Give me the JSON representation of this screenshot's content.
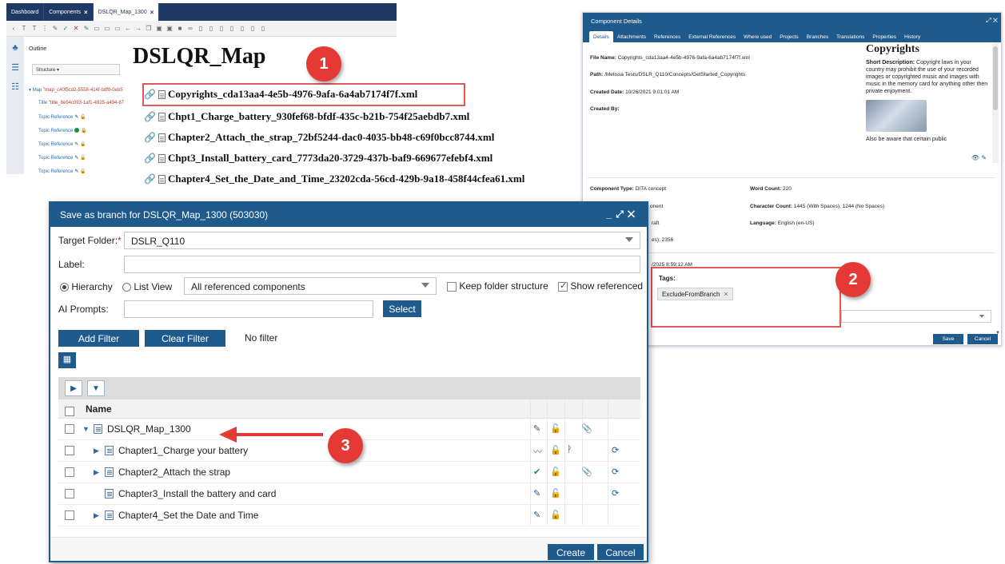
{
  "editor": {
    "tabs": [
      {
        "label": "Dashboard",
        "closable": false
      },
      {
        "label": "Components",
        "closable": true
      },
      {
        "label": "DSLQR_Map_1300",
        "closable": true
      }
    ],
    "outline_label": "Outline",
    "structure_label": "Structure ▾",
    "tree": [
      {
        "type": "Map",
        "value": "\"map_c40f5cd2-5558-414f-bdf0-0eb5"
      },
      {
        "type": "Title",
        "value": "\"title_8e54c093-1af1-4925-a494-87"
      },
      {
        "type": "Topic Reference",
        "status": "edit"
      },
      {
        "type": "Topic Reference",
        "status": "ok"
      },
      {
        "type": "Topic Reference",
        "status": "edit"
      },
      {
        "type": "Topic Reference",
        "status": "edit"
      },
      {
        "type": "Topic Reference",
        "status": "edit"
      }
    ],
    "doc_title": "DSLQR_Map",
    "links": [
      "Copyrights_cda13aa4-4e5b-4976-9afa-6a4ab7174f7f.xml",
      "Chpt1_Charge_battery_930fef68-bfdf-435c-b21b-754f25aebdb7.xml",
      "Chapter2_Attach_the_strap_72bf5244-dac0-4035-bb48-c69f0bcc8744.xml",
      "Chpt3_Install_battery_card_7773da20-3729-437b-baf9-669677efebf4.xml",
      "Chapter4_Set_the_Date_and_Time_23202cda-56cd-429b-9a18-458f44cfea61.xml"
    ]
  },
  "badges": [
    "1",
    "2",
    "3"
  ],
  "details": {
    "title": "Component Details",
    "tabs": [
      "Details",
      "Attachments",
      "References",
      "External References",
      "Where used",
      "Projects",
      "Branches",
      "Translations",
      "Properties",
      "History"
    ],
    "file_name_label": "File Name:",
    "file_name": "Copyrights_cda13aa4-4e5b-4976-9afa-6a4ab7174f7f.xml",
    "path_label": "Path:",
    "path": "/Melissa Tests/DSLR_Q110/Concepts/GetStarted_Copyrights",
    "created_date_label": "Created Date:",
    "created_date": "10/26/2021 9:01:01 AM",
    "created_by_label": "Created By:",
    "preview_title": "Copyrights",
    "preview_short_label": "Short Description:",
    "preview_short": "Copyright laws in your country may prohibit the use of your recorded images or copyrighted music and images with music in the memory card for anything other then private enjoyment.",
    "preview_more": "Also be aware that certain public",
    "component_type_label": "Component Type:",
    "component_type": "DITA concept",
    "word_count_label": "Word Count:",
    "word_count": "220",
    "partial_component": "onent",
    "char_count_label": "Character Count:",
    "char_count": "1445 (With Spaces), 1244 (No Spaces)",
    "partial_status": "raft",
    "language_label": "Language:",
    "language": "English (en-US)",
    "partial_size": "es): 2356",
    "partial_modified": "/2025 8:59:12 AM",
    "tags_label": "Tags:",
    "tag": "ExcludeFromBranch",
    "save": "Save",
    "cancel": "Cancel"
  },
  "dialog": {
    "title": "Save as branch for DSLQR_Map_1300 (503030)",
    "target_folder_label": "Target Folder:",
    "target_folder_value": "DSLR_Q110",
    "label_label": "Label:",
    "label_value": "",
    "view_hierarchy": "Hierarchy",
    "view_list": "List View",
    "scope_value": "All referenced components",
    "keep_folder": "Keep folder structure",
    "show_referenced": "Show referenced",
    "ai_prompts_label": "AI Prompts:",
    "select_button": "Select",
    "add_filter": "Add Filter",
    "clear_filter": "Clear Filter",
    "filter_status": "No filter",
    "name_header": "Name",
    "rows": [
      {
        "label": "DSLQR_Map_1300",
        "level": 0,
        "expander": "open"
      },
      {
        "label": "Chapter1_Charge your battery",
        "level": 1,
        "expander": "closed"
      },
      {
        "label": "Chapter2_Attach the strap",
        "level": 1,
        "expander": "closed"
      },
      {
        "label": "Chapter3_Install the battery and card",
        "level": 1,
        "expander": "none"
      },
      {
        "label": "Chapter4_Set the Date and Time",
        "level": 1,
        "expander": "closed"
      }
    ],
    "create": "Create",
    "cancel": "Cancel"
  }
}
